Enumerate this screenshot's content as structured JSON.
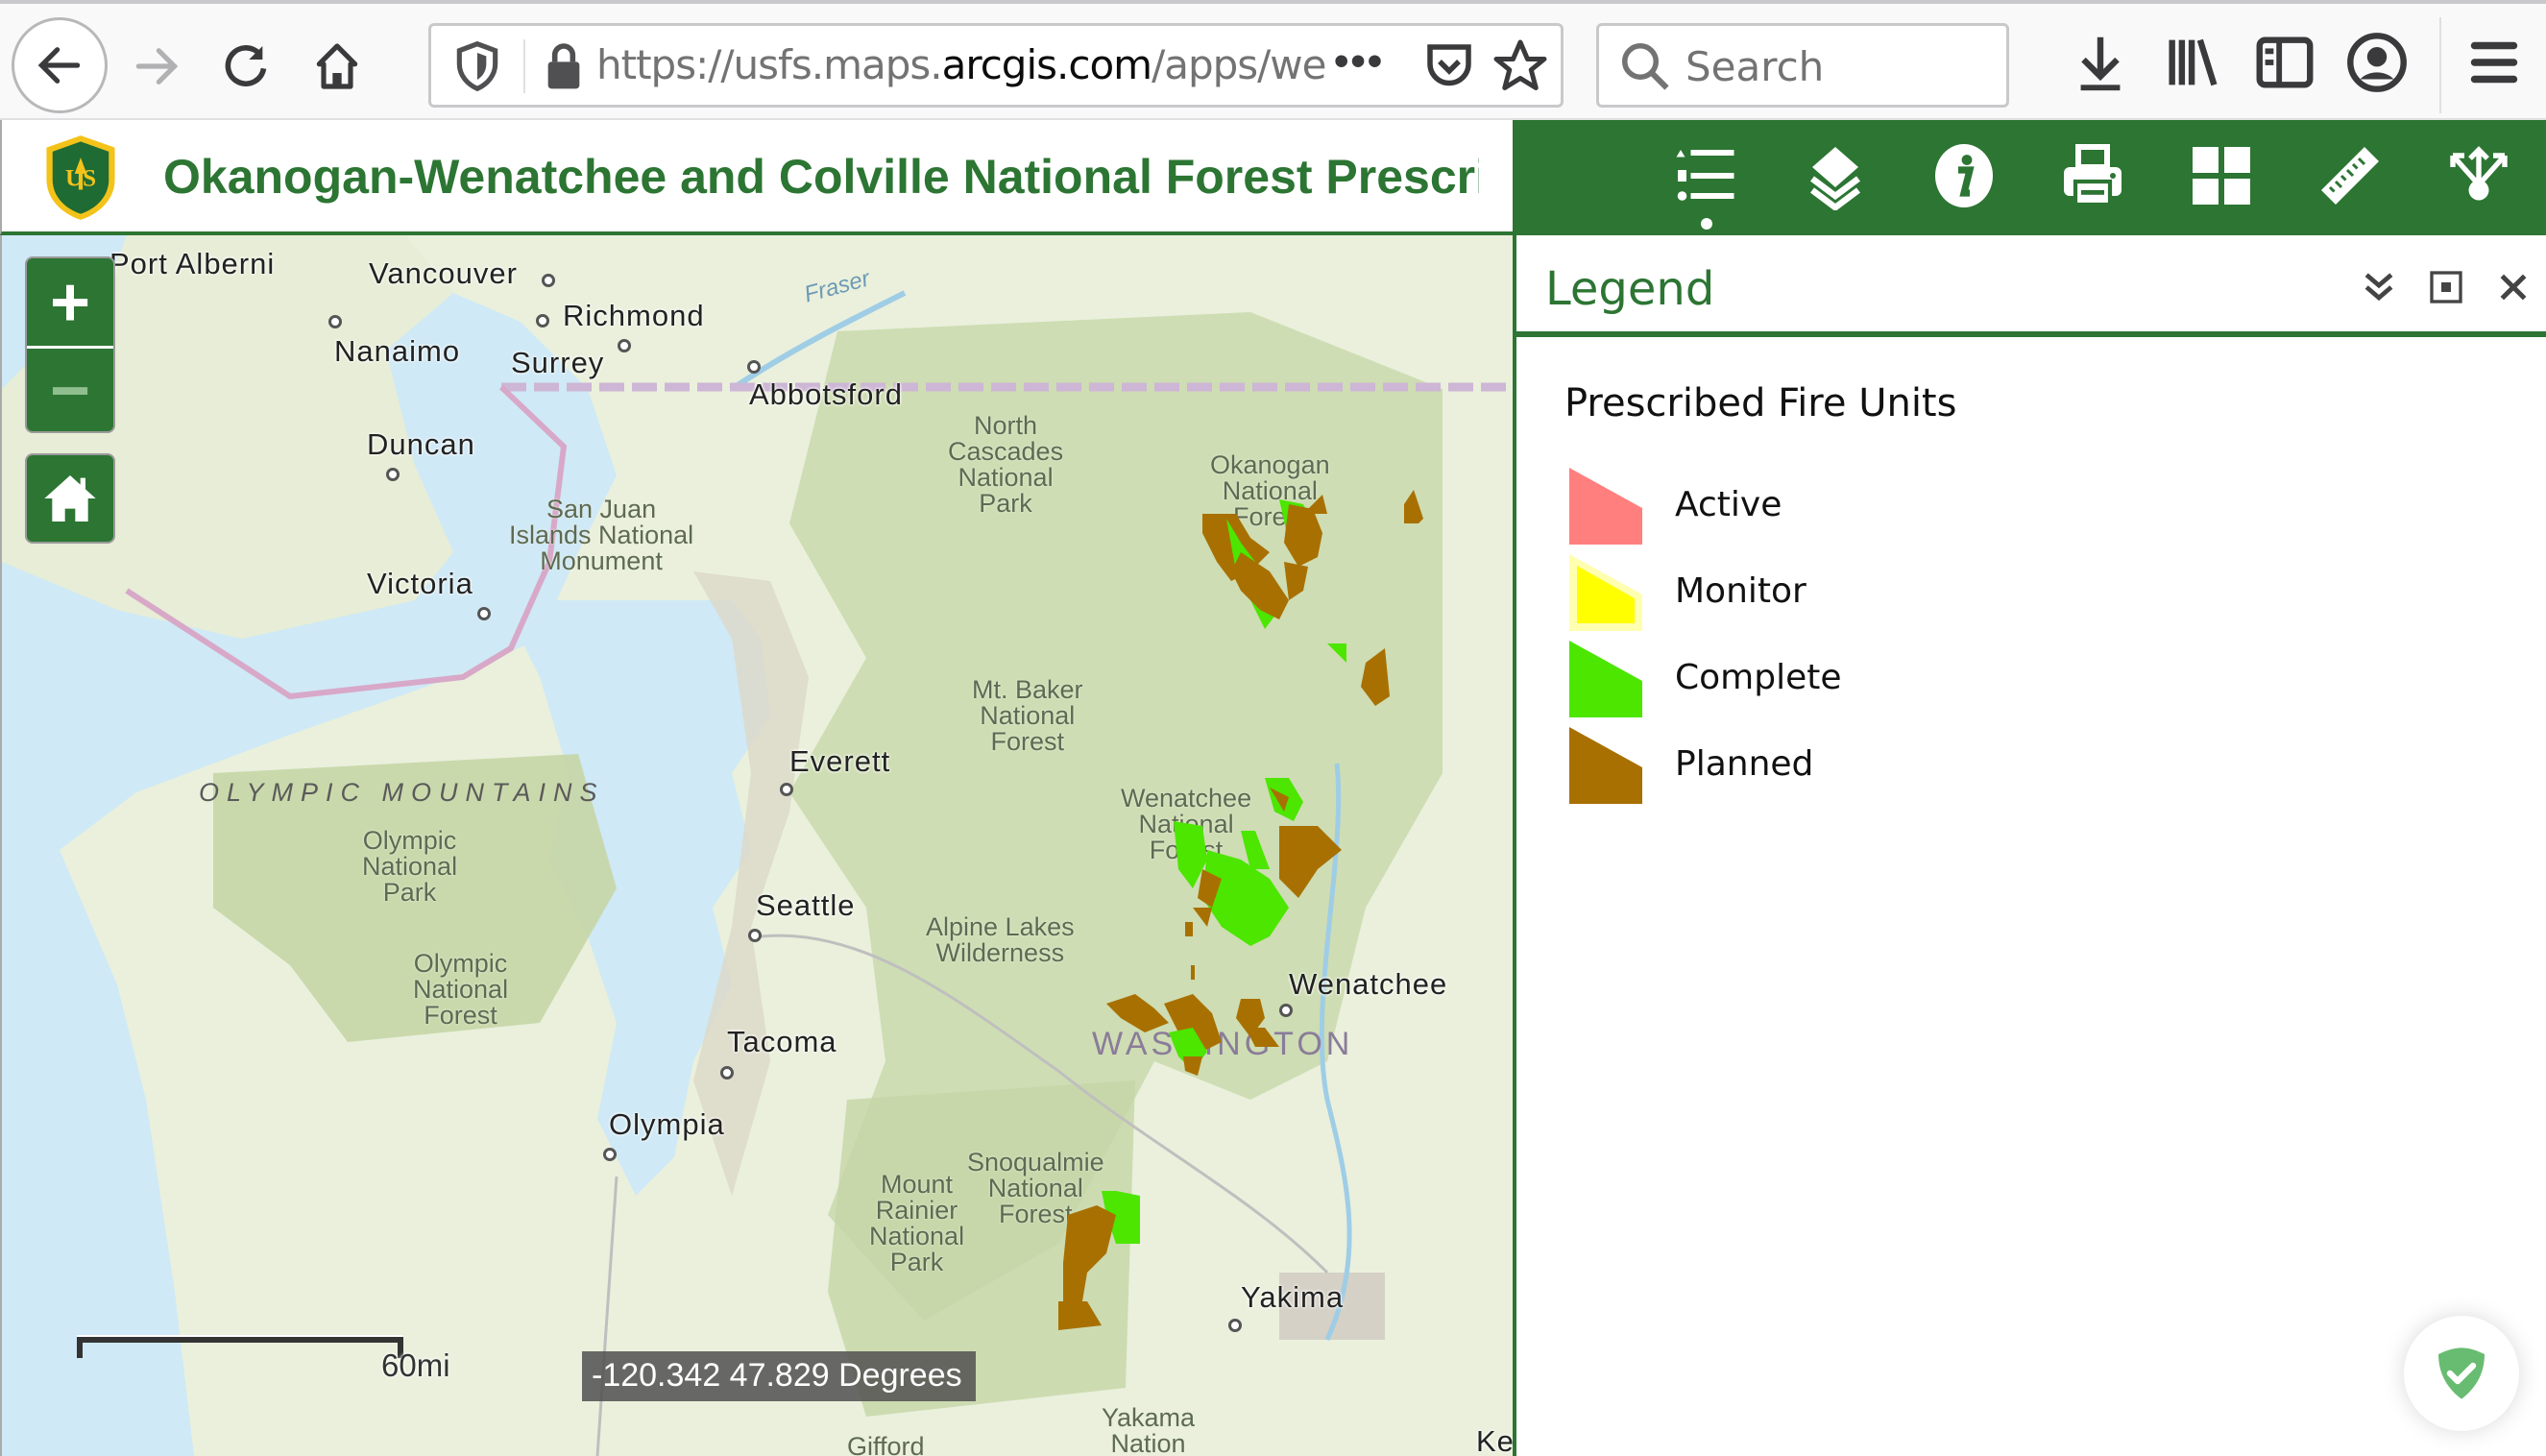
{
  "browser": {
    "url_prefix": "https://usfs.maps.",
    "url_domain": "arcgis.com",
    "url_suffix": "/apps/webap",
    "url_more": "•••",
    "search_placeholder": "Search",
    "icons": [
      "back-icon",
      "forward-icon",
      "reload-icon",
      "home-icon",
      "tracking-shield-icon",
      "lock-icon",
      "page-actions-icon",
      "pocket-icon",
      "bookmark-star-icon",
      "search-icon",
      "download-icon",
      "library-icon",
      "sidebar-icon",
      "account-icon",
      "menu-icon"
    ]
  },
  "app": {
    "title": "Okanogan-Wenatchee and Colville National Forest Prescribed Fire",
    "logo_text": "US",
    "theme_color": "#2c7533",
    "toolbar": [
      {
        "name": "legend",
        "icon": "legend-list-icon",
        "active": true
      },
      {
        "name": "layers",
        "icon": "layers-icon",
        "active": false
      },
      {
        "name": "about",
        "icon": "info-icon",
        "active": false
      },
      {
        "name": "print",
        "icon": "print-icon",
        "active": false
      },
      {
        "name": "basemap-gallery",
        "icon": "grid-icon",
        "active": false
      },
      {
        "name": "measurement",
        "icon": "ruler-icon",
        "active": false
      },
      {
        "name": "share",
        "icon": "share-icon",
        "active": false
      }
    ]
  },
  "map": {
    "zoom_in": "+",
    "zoom_out": "−",
    "scale_label": "60mi",
    "coordinates": "-120.342 47.829 Degrees",
    "cities": [
      {
        "name": "Port Alberni"
      },
      {
        "name": "Vancouver"
      },
      {
        "name": "Richmond"
      },
      {
        "name": "Nanaimo"
      },
      {
        "name": "Surrey"
      },
      {
        "name": "Abbotsford"
      },
      {
        "name": "Duncan"
      },
      {
        "name": "Victoria"
      },
      {
        "name": "Everett"
      },
      {
        "name": "Seattle"
      },
      {
        "name": "Tacoma"
      },
      {
        "name": "Olympia"
      },
      {
        "name": "Wenatchee"
      },
      {
        "name": "Yakima"
      }
    ],
    "parks": [
      "North\nCascades\nNational\nPark",
      "Okanogan\nNational\nForest",
      "San Juan\nIslands National\nMonument",
      "Mt. Baker\nNational\nForest",
      "Wenatchee\nNational\nForest",
      "Olympic\nNational\nPark",
      "Olympic\nNational\nForest",
      "Alpine Lakes\nWilderness",
      "Snoqualmie\nNational\nForest",
      "Mount\nRainier\nNational\nPark",
      "Yakama\nNation",
      "Gifford"
    ],
    "range_label": "OLYMPIC MOUNTAINS",
    "state_label": "WASHINGTON",
    "water_label": "Fraser",
    "edge_label": "Ke"
  },
  "legend": {
    "title": "Legend",
    "layer_title": "Prescribed Fire Units",
    "items": [
      {
        "label": "Active",
        "color": "#ff7f7f"
      },
      {
        "label": "Monitor",
        "color": "#ffff00"
      },
      {
        "label": "Complete",
        "color": "#4ce600"
      },
      {
        "label": "Planned",
        "color": "#a87000"
      }
    ]
  }
}
